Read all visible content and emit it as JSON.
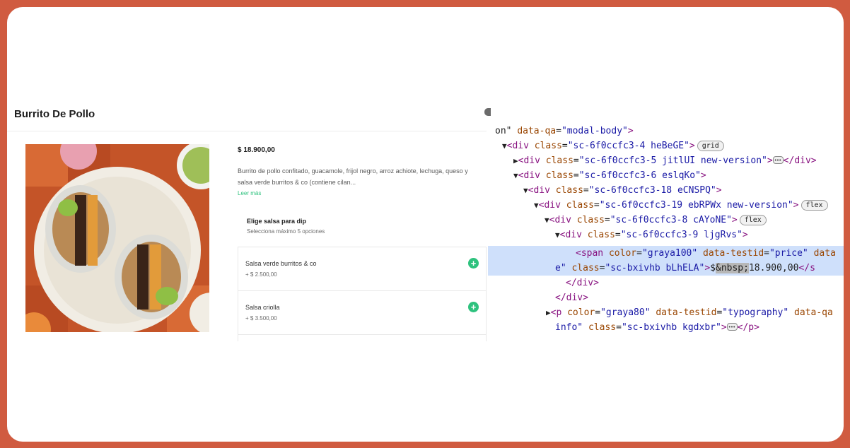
{
  "modal": {
    "title": "Burrito De Pollo",
    "price": "$ 18.900,00",
    "description": "Burrito de pollo confitado, guacamole, frijol negro, arroz achiote, lechuga, queso y salsa verde burritos & co (contiene cilan...",
    "read_more": "Leer más",
    "section": {
      "title": "Elige salsa para dip",
      "subtitle": "Selecciona máximo 5 opciones"
    },
    "options": [
      {
        "name": "Salsa verde burritos & co",
        "price": "+ $ 2.500,00"
      },
      {
        "name": "Salsa criolla",
        "price": "+ $ 3.500,00"
      }
    ],
    "colors": {
      "accent": "#2ec27e",
      "frame": "#d05b40"
    }
  },
  "devtools": {
    "lines": [
      {
        "pre": "on\" ",
        "a1": "data-qa",
        "v1": "\"modal-body\"",
        "post": ">"
      },
      {
        "tag": "<div ",
        "a1": "class",
        "v1": "\"sc-6f0ccfc3-4 heBeGE\"",
        "close": ">",
        "badge": "grid"
      },
      {
        "tag": "<div ",
        "a1": "class",
        "v1": "\"sc-6f0ccfc3-5 jitlUI new-version\"",
        "close": ">",
        "tail": "</div>"
      },
      {
        "tag": "<div ",
        "a1": "class",
        "v1": "\"sc-6f0ccfc3-6 eslqKo\"",
        "close": ">"
      },
      {
        "tag": "<div ",
        "a1": "class",
        "v1": "\"sc-6f0ccfc3-18 eCNSPQ\"",
        "close": ">"
      },
      {
        "tag": "<div ",
        "a1": "class",
        "v1": "\"sc-6f0ccfc3-19 ebRPWx new-version\"",
        "close": ">",
        "badge": "flex"
      },
      {
        "tag": "<div ",
        "a1": "class",
        "v1": "\"sc-6f0ccfc3-8 cAYoNE\"",
        "close": ">",
        "badge": "flex"
      },
      {
        "tag": "<div ",
        "a1": "class",
        "v1": "\"sc-6f0ccfc3-9 ljgRvs\"",
        "close": ">"
      },
      {
        "tag": "<span ",
        "a1": "color",
        "v1": "\"graya100\"",
        "a2": "data-testid",
        "v2": "\"price\"",
        "a3": "data"
      },
      {
        "pre": "e\" ",
        "a1": "class",
        "v1": "\"sc-bxivhb bLhELA\"",
        "close": ">",
        "text1": "$",
        "sel": "&nbsp;",
        "text2": "18.900,00",
        "end": "</s"
      },
      {
        "tag": "</div>"
      },
      {
        "tag": "</div>"
      },
      {
        "tag": "<p ",
        "a1": "color",
        "v1": "\"graya80\"",
        "a2": "data-testid",
        "v2": "\"typography\"",
        "a3": "data-qa"
      },
      {
        "pre": "info\" ",
        "a1": "class",
        "v1": "\"sc-bxivhb kgdxbr\"",
        "close": ">",
        "tail": "</p>"
      }
    ]
  }
}
